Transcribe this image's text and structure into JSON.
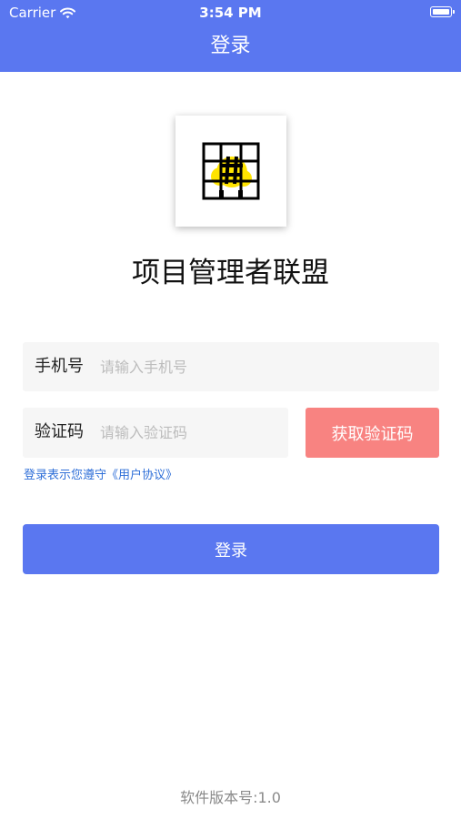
{
  "status_bar": {
    "carrier": "Carrier",
    "time": "3:54 PM",
    "wifi_icon": "wifi-icon",
    "battery_icon": "battery-icon"
  },
  "nav": {
    "title": "登录"
  },
  "logo": {
    "icon": "app-logo-hash-grid-icon",
    "accent_color": "#ffe400"
  },
  "app_name": "项目管理者联盟",
  "phone": {
    "label": "手机号",
    "placeholder": "请输入手机号",
    "value": ""
  },
  "code": {
    "label": "验证码",
    "placeholder": "请输入验证码",
    "value": "",
    "button_label": "获取验证码"
  },
  "agreement": {
    "text": "登录表示您遵守《用户协议》"
  },
  "login": {
    "button_label": "登录"
  },
  "version": {
    "text": "软件版本号:1.0"
  },
  "colors": {
    "primary": "#5a77f0",
    "code_button": "#f88381",
    "link": "#2f6fd8",
    "field_bg": "#f6f6f6"
  }
}
